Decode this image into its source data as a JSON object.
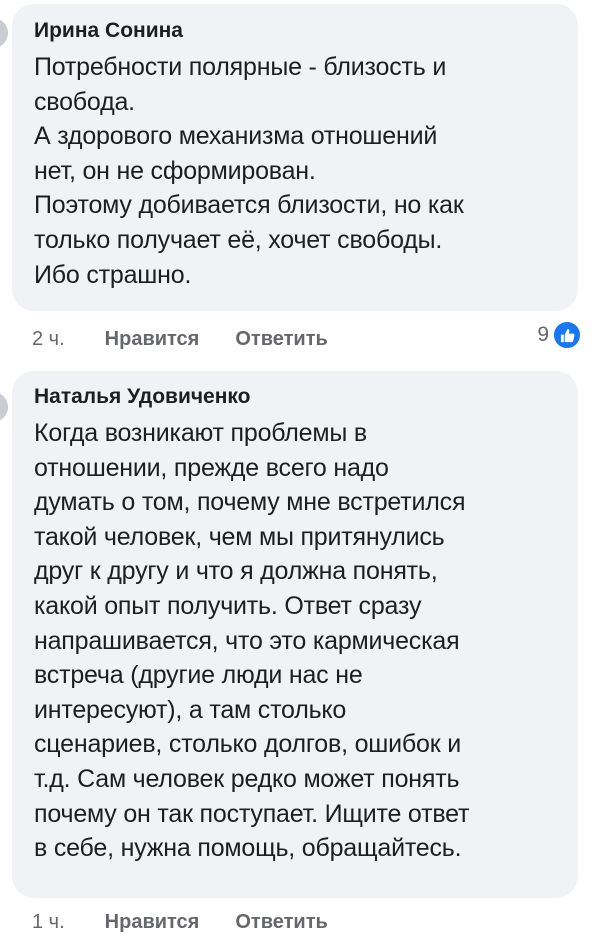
{
  "comments": [
    {
      "author": "Ирина Сонина",
      "text": "Потребности полярные - близость и\nсвобода.\nА здорового механизма отношений\nнет, он не сформирован.\nПоэтому добивается близости, но как\nтолько получает её, хочет свободы.\nИбо страшно.",
      "time": "2 ч.",
      "like_label": "Нравится",
      "reply_label": "Ответить",
      "reaction_count": "9",
      "reaction_icon": "thumbs-up-icon",
      "reaction_color": "#1877f2"
    },
    {
      "author": "Наталья Удовиченко",
      "text": "Когда возникают проблемы в\nотношении, прежде всего надо\nдумать о том, почему мне встретился\nтакой человек, чем мы притянулись\nдруг к другу и что  я должна понять,\nкакой опыт получить. Ответ сразу\nнапрашивается, что это кармическая\nвстреча (другие люди нас не\nинтересуют), а там столько\nсценариев, столько долгов, ошибок и\nт.д. Сам человек редко  может понять\nпочему он так поступает. Ищите ответ\nв себе, нужна помощь, обращайтесь.",
      "time": "1 ч.",
      "like_label": "Нравится",
      "reply_label": "Ответить"
    }
  ],
  "colors": {
    "bubble_background": "#f0f2f5",
    "text": "#1c1e21",
    "secondary_text": "#65676b"
  }
}
